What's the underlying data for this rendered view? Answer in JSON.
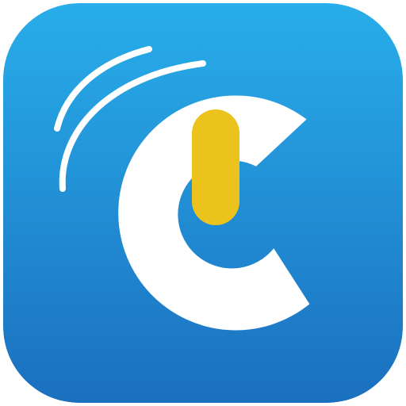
{
  "app_icon": {
    "icon_name": "power-c-logo-icon",
    "colors": {
      "background_top": "#28aeea",
      "background_bottom": "#1b6fbf",
      "mark": "#ffffff",
      "accent": "#ecc21c"
    }
  }
}
